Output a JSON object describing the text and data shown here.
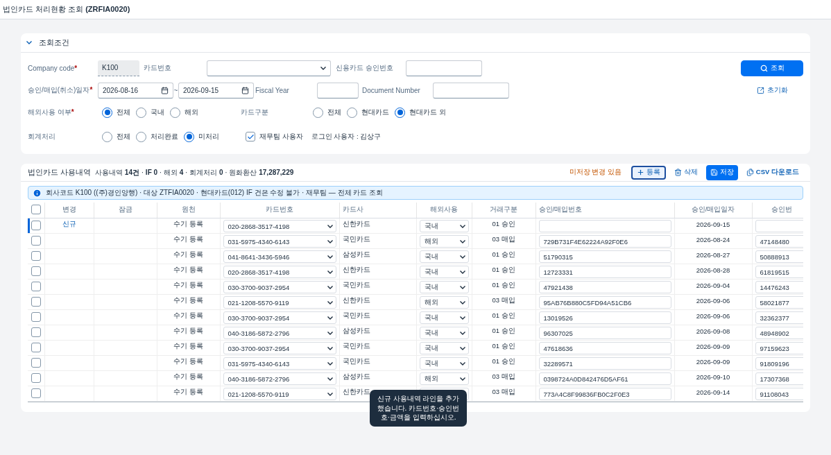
{
  "page_title": "법인카드 처리현황 조회 **(ZRFIA0020)**",
  "filters": {
    "title": "조회조건",
    "expanded": true,
    "company_code": {
      "label": "Company code",
      "required_mark": "*",
      "value": "K100"
    },
    "card_number": {
      "label": "카드번호"
    },
    "approval_no": {
      "label": "신용카드 승인번호"
    },
    "date_range": {
      "label": "승인/매입(취소)일자",
      "required_mark": "*",
      "from": "2026-08-16",
      "separator": "~",
      "to": "2026-09-15"
    },
    "fiscal_year": {
      "label": "Fiscal Year"
    },
    "document_number": {
      "label": "Document Number"
    },
    "overseas": {
      "label": "해외사용 여부",
      "required_mark": "*",
      "options": [
        {
          "label": "전체",
          "selected": true
        },
        {
          "label": "국내",
          "selected": false
        },
        {
          "label": "해외",
          "selected": false
        }
      ]
    },
    "card_type": {
      "label": "카드구분",
      "options": [
        {
          "label": "전체",
          "selected": false
        },
        {
          "label": "현대카드",
          "selected": false
        },
        {
          "label": "현대카드 외",
          "selected": true
        }
      ]
    },
    "accounting": {
      "label": "회계처리",
      "options": [
        {
          "label": "전체",
          "selected": false
        },
        {
          "label": "처리완료",
          "selected": false
        },
        {
          "label": "미처리",
          "selected": true
        }
      ]
    },
    "finance_user": {
      "label": "재무팀 사용자",
      "checked": true
    },
    "login_user": "로그인 사용자 : 김상구",
    "search_button": "조회",
    "reset_button": "초기화"
  },
  "usage": {
    "title": "법인카드 사용내역",
    "summary": "사용내역 **14건** · **IF 0** · 해외 **4** · 회계처리 **0** · 원화환산 **17,287,229**",
    "unsaved_notice": "미저장 변경 있음",
    "actions": [
      {
        "label": "등록",
        "kind": "add"
      },
      {
        "label": "삭제",
        "kind": "delete"
      },
      {
        "label": "저장",
        "kind": "save"
      },
      {
        "label": "CSV 다운로드",
        "kind": "csv"
      }
    ],
    "info": "회사코드 K100 ((주)경인양행) · 대상 ZTFIA0020 · 현대카드(012) IF 건은 수정 불가 · 재무팀 — 전체 카드 조회",
    "all_checked": false,
    "columns": [
      "변경",
      "잠금",
      "원천",
      "카드번호",
      "카드사",
      "해외사용",
      "거래구분",
      "승인/매입번호",
      "승인/매입일자",
      "승인번"
    ],
    "rows": [
      {
        "selected": true,
        "checked": false,
        "change": "신규",
        "source": "수기 등록",
        "card": "020-2868-3517-4198",
        "company": "신한카드",
        "overseas": "국내",
        "type": "01 승인",
        "approval": "",
        "date": "2026-09-15",
        "approval2": ""
      },
      {
        "selected": false,
        "checked": false,
        "source": "수기 등록",
        "card": "031-5975-4340-6143",
        "company": "국민카드",
        "overseas": "해외",
        "type": "03 매입",
        "approval": "729B731F4E62224A92F0E6",
        "date": "2026-08-24",
        "approval2": "47148480"
      },
      {
        "selected": false,
        "checked": false,
        "source": "수기 등록",
        "card": "041-8641-3436-5946",
        "company": "삼성카드",
        "overseas": "국내",
        "type": "01 승인",
        "approval": "51790315",
        "date": "2026-08-27",
        "approval2": "50888913"
      },
      {
        "selected": false,
        "checked": false,
        "source": "수기 등록",
        "card": "020-2868-3517-4198",
        "company": "신한카드",
        "overseas": "국내",
        "type": "01 승인",
        "approval": "12723331",
        "date": "2026-08-28",
        "approval2": "61819515"
      },
      {
        "selected": false,
        "checked": false,
        "source": "수기 등록",
        "card": "030-3700-9037-2954",
        "company": "국민카드",
        "overseas": "국내",
        "type": "01 승인",
        "approval": "47921438",
        "date": "2026-09-04",
        "approval2": "14476243"
      },
      {
        "selected": false,
        "checked": false,
        "source": "수기 등록",
        "card": "021-1208-5570-9119",
        "company": "신한카드",
        "overseas": "해외",
        "type": "03 매입",
        "approval": "95AB76B880C5FD94A51CB6",
        "date": "2026-09-06",
        "approval2": "58021877"
      },
      {
        "selected": false,
        "checked": false,
        "source": "수기 등록",
        "card": "030-3700-9037-2954",
        "company": "국민카드",
        "overseas": "국내",
        "type": "01 승인",
        "approval": "13019526",
        "date": "2026-09-06",
        "approval2": "32362377"
      },
      {
        "selected": false,
        "checked": false,
        "source": "수기 등록",
        "card": "040-3186-5872-2796",
        "company": "삼성카드",
        "overseas": "국내",
        "type": "01 승인",
        "approval": "96307025",
        "date": "2026-09-08",
        "approval2": "48948902"
      },
      {
        "selected": false,
        "checked": false,
        "source": "수기 등록",
        "card": "030-3700-9037-2954",
        "company": "국민카드",
        "overseas": "국내",
        "type": "01 승인",
        "approval": "47618636",
        "date": "2026-09-09",
        "approval2": "97159623"
      },
      {
        "selected": false,
        "checked": false,
        "source": "수기 등록",
        "card": "031-5975-4340-6143",
        "company": "국민카드",
        "overseas": "국내",
        "type": "01 승인",
        "approval": "32289571",
        "date": "2026-09-09",
        "approval2": "91809196"
      },
      {
        "selected": false,
        "checked": false,
        "source": "수기 등록",
        "card": "040-3186-5872-2796",
        "company": "삼성카드",
        "overseas": "해외",
        "type": "03 매입",
        "approval": "0398724A0D842476D5AF61",
        "date": "2026-09-10",
        "approval2": "17307368"
      },
      {
        "selected": false,
        "checked": false,
        "source": "수기 등록",
        "card": "021-1208-5570-9119",
        "company": "신한카드",
        "type": "03 매입",
        "approval": "773A4C8F99836FB0C2F0E3",
        "date": "2026-09-14",
        "approval2": "91108043"
      }
    ]
  },
  "toast": "신규 사용내역 라인을 추가했습니다. 카드번호·승인번호·금액을 입력하십시오."
}
